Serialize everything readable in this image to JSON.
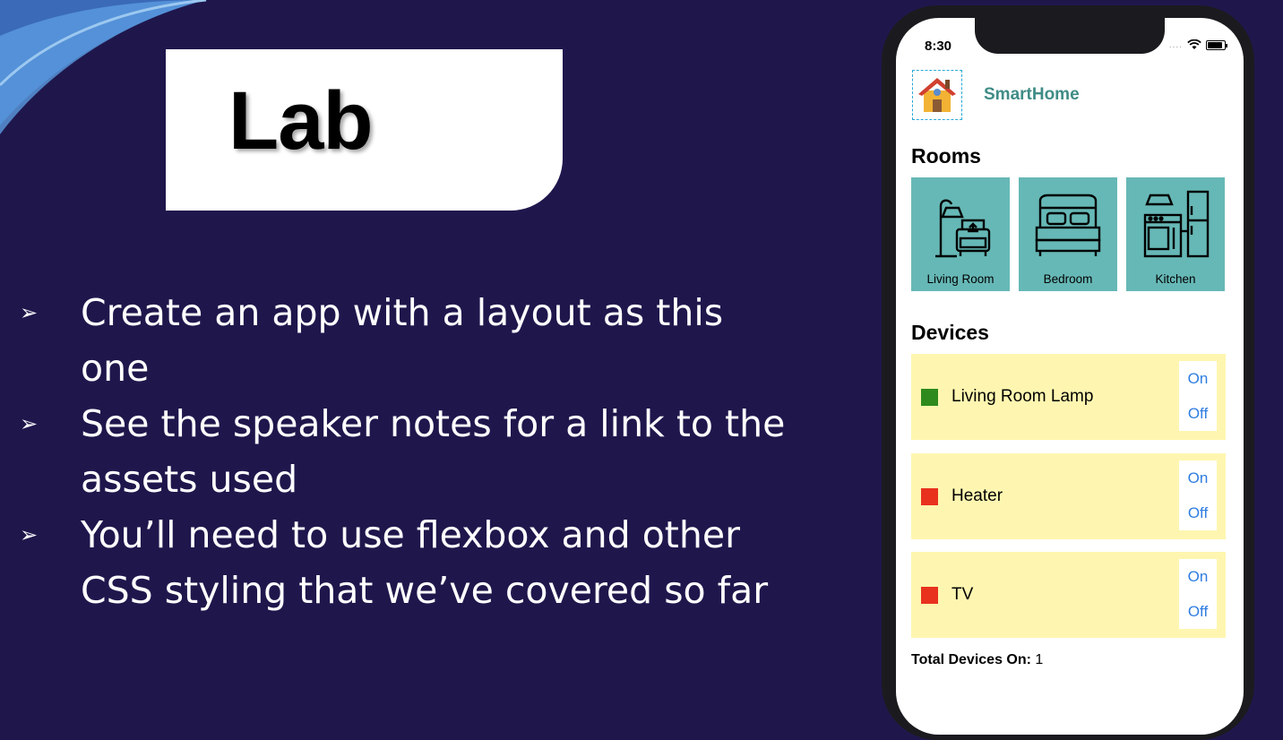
{
  "slide": {
    "title": "Lab",
    "bullets": [
      "Create an app with a layout as this one",
      "See the speaker notes for a link to the assets used",
      "You’ll need to use flexbox and other CSS styling that we’ve covered so far"
    ],
    "bullet_marker": "➢"
  },
  "phone": {
    "time": "8:30",
    "status_dots": "....",
    "app_name": "SmartHome",
    "rooms_title": "Rooms",
    "rooms": [
      {
        "label": "Living Room",
        "icon": "living-room-icon"
      },
      {
        "label": "Bedroom",
        "icon": "bed-icon"
      },
      {
        "label": "Kitchen",
        "icon": "kitchen-icon"
      }
    ],
    "devices_title": "Devices",
    "devices": [
      {
        "name": "Living Room Lamp",
        "status_color": "#2e8a1c",
        "on_label": "On",
        "off_label": "Off"
      },
      {
        "name": "Heater",
        "status_color": "#e8321e",
        "on_label": "On",
        "off_label": "Off"
      },
      {
        "name": "TV",
        "status_color": "#e8321e",
        "on_label": "On",
        "off_label": "Off"
      }
    ],
    "total_label": "Total Devices On:",
    "total_value": "1"
  },
  "colors": {
    "background": "#1f174c",
    "accent_teal": "#66b8b6",
    "app_name": "#3f8c86",
    "device_bg": "#fef6b0",
    "link_blue": "#2f7de0"
  }
}
